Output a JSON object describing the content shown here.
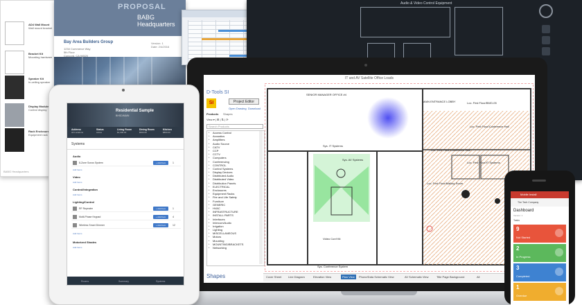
{
  "doc_left": {
    "rows": [
      {
        "title": "AD4 Wall Mount",
        "desc": "Wall mount bracket"
      },
      {
        "title": "Bracket Kit",
        "desc": "Mounting hardware"
      },
      {
        "title": "Speaker Kit",
        "desc": "In-ceiling speaker"
      },
      {
        "title": "Display Module",
        "desc": "Control display"
      },
      {
        "title": "Rack Enclosure",
        "desc": "Equipment rack"
      }
    ],
    "footer": "BABG Headquarters"
  },
  "proposal": {
    "heading": "PROPOSAL",
    "project": "BABG Headquarters",
    "client": "Bay Area Builders Group",
    "address": [
      "1234 Commerce Way",
      "5th Floor",
      "Concord, CA 94520"
    ],
    "version": [
      "Version: 1",
      "Date: 2/4/2016"
    ]
  },
  "cad_dark": {
    "title": "Audio & Video Control Equipment"
  },
  "laptop": {
    "window_title": "IT and AV Satellite Office Loads",
    "app_name": "D-Tools SI",
    "logo": "SI",
    "project_editor": "Project Editor",
    "open_drawing": "Open Drawing",
    "download": "Download",
    "tab_products": "Products",
    "tab_shapes": "Shapes",
    "tree_toolbar": "View ▾ | ⊞ | ⇅ | ⟳",
    "search_placeholder": "Search Products",
    "products": [
      "Access Control",
      "Acoustics",
      "Amplifiers",
      "Audio Source",
      "CATV",
      "CCP",
      "CCTV",
      "Computers",
      "Conferencing",
      "CONTROL",
      "Control Systems",
      "Display Devices",
      "Distributed Audio",
      "Distributed Video",
      "Distribution Panels",
      "ELECTRICAL",
      "Enclosures",
      "Equipment Racks",
      "Fire and Life Safety",
      "Furniture",
      "GENERIC",
      "HVAC",
      "INFRASTRUCTURE",
      "INSTALL PARTS",
      "Interfaces",
      "Intercom/Audio",
      "Irrigation",
      "Lighting",
      "MISCELLANEOUS",
      "Motors",
      "Mounting",
      "MOUNTING/BRACKETS",
      "Networking"
    ],
    "shapes_label": "Shapes",
    "sheet_tabs": [
      "Cover Sheet",
      "Line Diagram",
      "Elevation View",
      "Plan View",
      "Phone/Data Schematic View",
      "AV Schematic View",
      "Title Page Background",
      "All"
    ],
    "active_tab": "Plan View",
    "drawing_labels": {
      "sales": "SENIOR MANAGER OFFICE #4",
      "it_systems": "Sys. IT Systems",
      "av_systems": "Sys. AV Systems",
      "first_floor": "Loc. First Floor/BMO-05",
      "first_floor_2": "Loc. First Floor/Conference Hall",
      "ff_mailing": "Loc. First Floor/Mailing Room",
      "first_floor_it": "Loc. First Floor/IT Systems",
      "video_conf": "Video Conf Kit",
      "sys_conf": "Sys. Conference System",
      "entrance": "MAIN ENTRANCE LOBBY",
      "ff_conf_hall": "Loc. First Floor/Conference Hall"
    }
  },
  "tablet": {
    "project_title": "Residential Sample",
    "project_subtitle": "BHSD/MAIN",
    "stats": [
      {
        "label": "Address",
        "value": "All Locations"
      },
      {
        "label": "Status",
        "value": "Active"
      },
      {
        "label": "Living Room",
        "value": "$1,000.00"
      },
      {
        "label": "Dining Room",
        "value": "$500.00"
      },
      {
        "label": "Kitchen",
        "value": "$800.00"
      }
    ],
    "systems_label": "Systems",
    "sections": [
      {
        "name": "Audio",
        "rows": [
          {
            "name": "8-Zone Sonos System",
            "btn": "+ Add Item",
            "count": "1"
          }
        ],
        "add": "Add Items"
      },
      {
        "name": "Video",
        "rows": [],
        "add": "Add Items"
      },
      {
        "name": "Control/Integration",
        "rows": [],
        "add": "Add Items"
      },
      {
        "name": "Lighting/Control",
        "rows": [
          {
            "name": "RF Repeater",
            "btn": "+ Add Item",
            "count": "1"
          },
          {
            "name": "Multi-Phase Keypad",
            "btn": "+ Add Item",
            "count": "4"
          },
          {
            "name": "Wireless Smart Dimmer",
            "btn": "+ Add Item",
            "count": "12"
          }
        ],
        "add": "Add Items"
      },
      {
        "name": "Motorized Shades",
        "rows": [],
        "add": "Add Items"
      }
    ],
    "footer_tabs": [
      "Rooms",
      "Summary",
      "Systems"
    ]
  },
  "phone": {
    "app_title": "Mobile Install",
    "company": "The Tech Company",
    "dashboard": "Dashboard",
    "version": "Version: 1",
    "tasks_label": "Tasks",
    "tiles": [
      {
        "count": "9",
        "label": "Not Started",
        "color": "#e8543b"
      },
      {
        "count": "2",
        "label": "In Progress",
        "color": "#5cb85c"
      },
      {
        "count": "3",
        "label": "Completed",
        "color": "#3e82d1"
      },
      {
        "count": "1",
        "label": "Overdue",
        "color": "#f0ad2e"
      }
    ]
  }
}
